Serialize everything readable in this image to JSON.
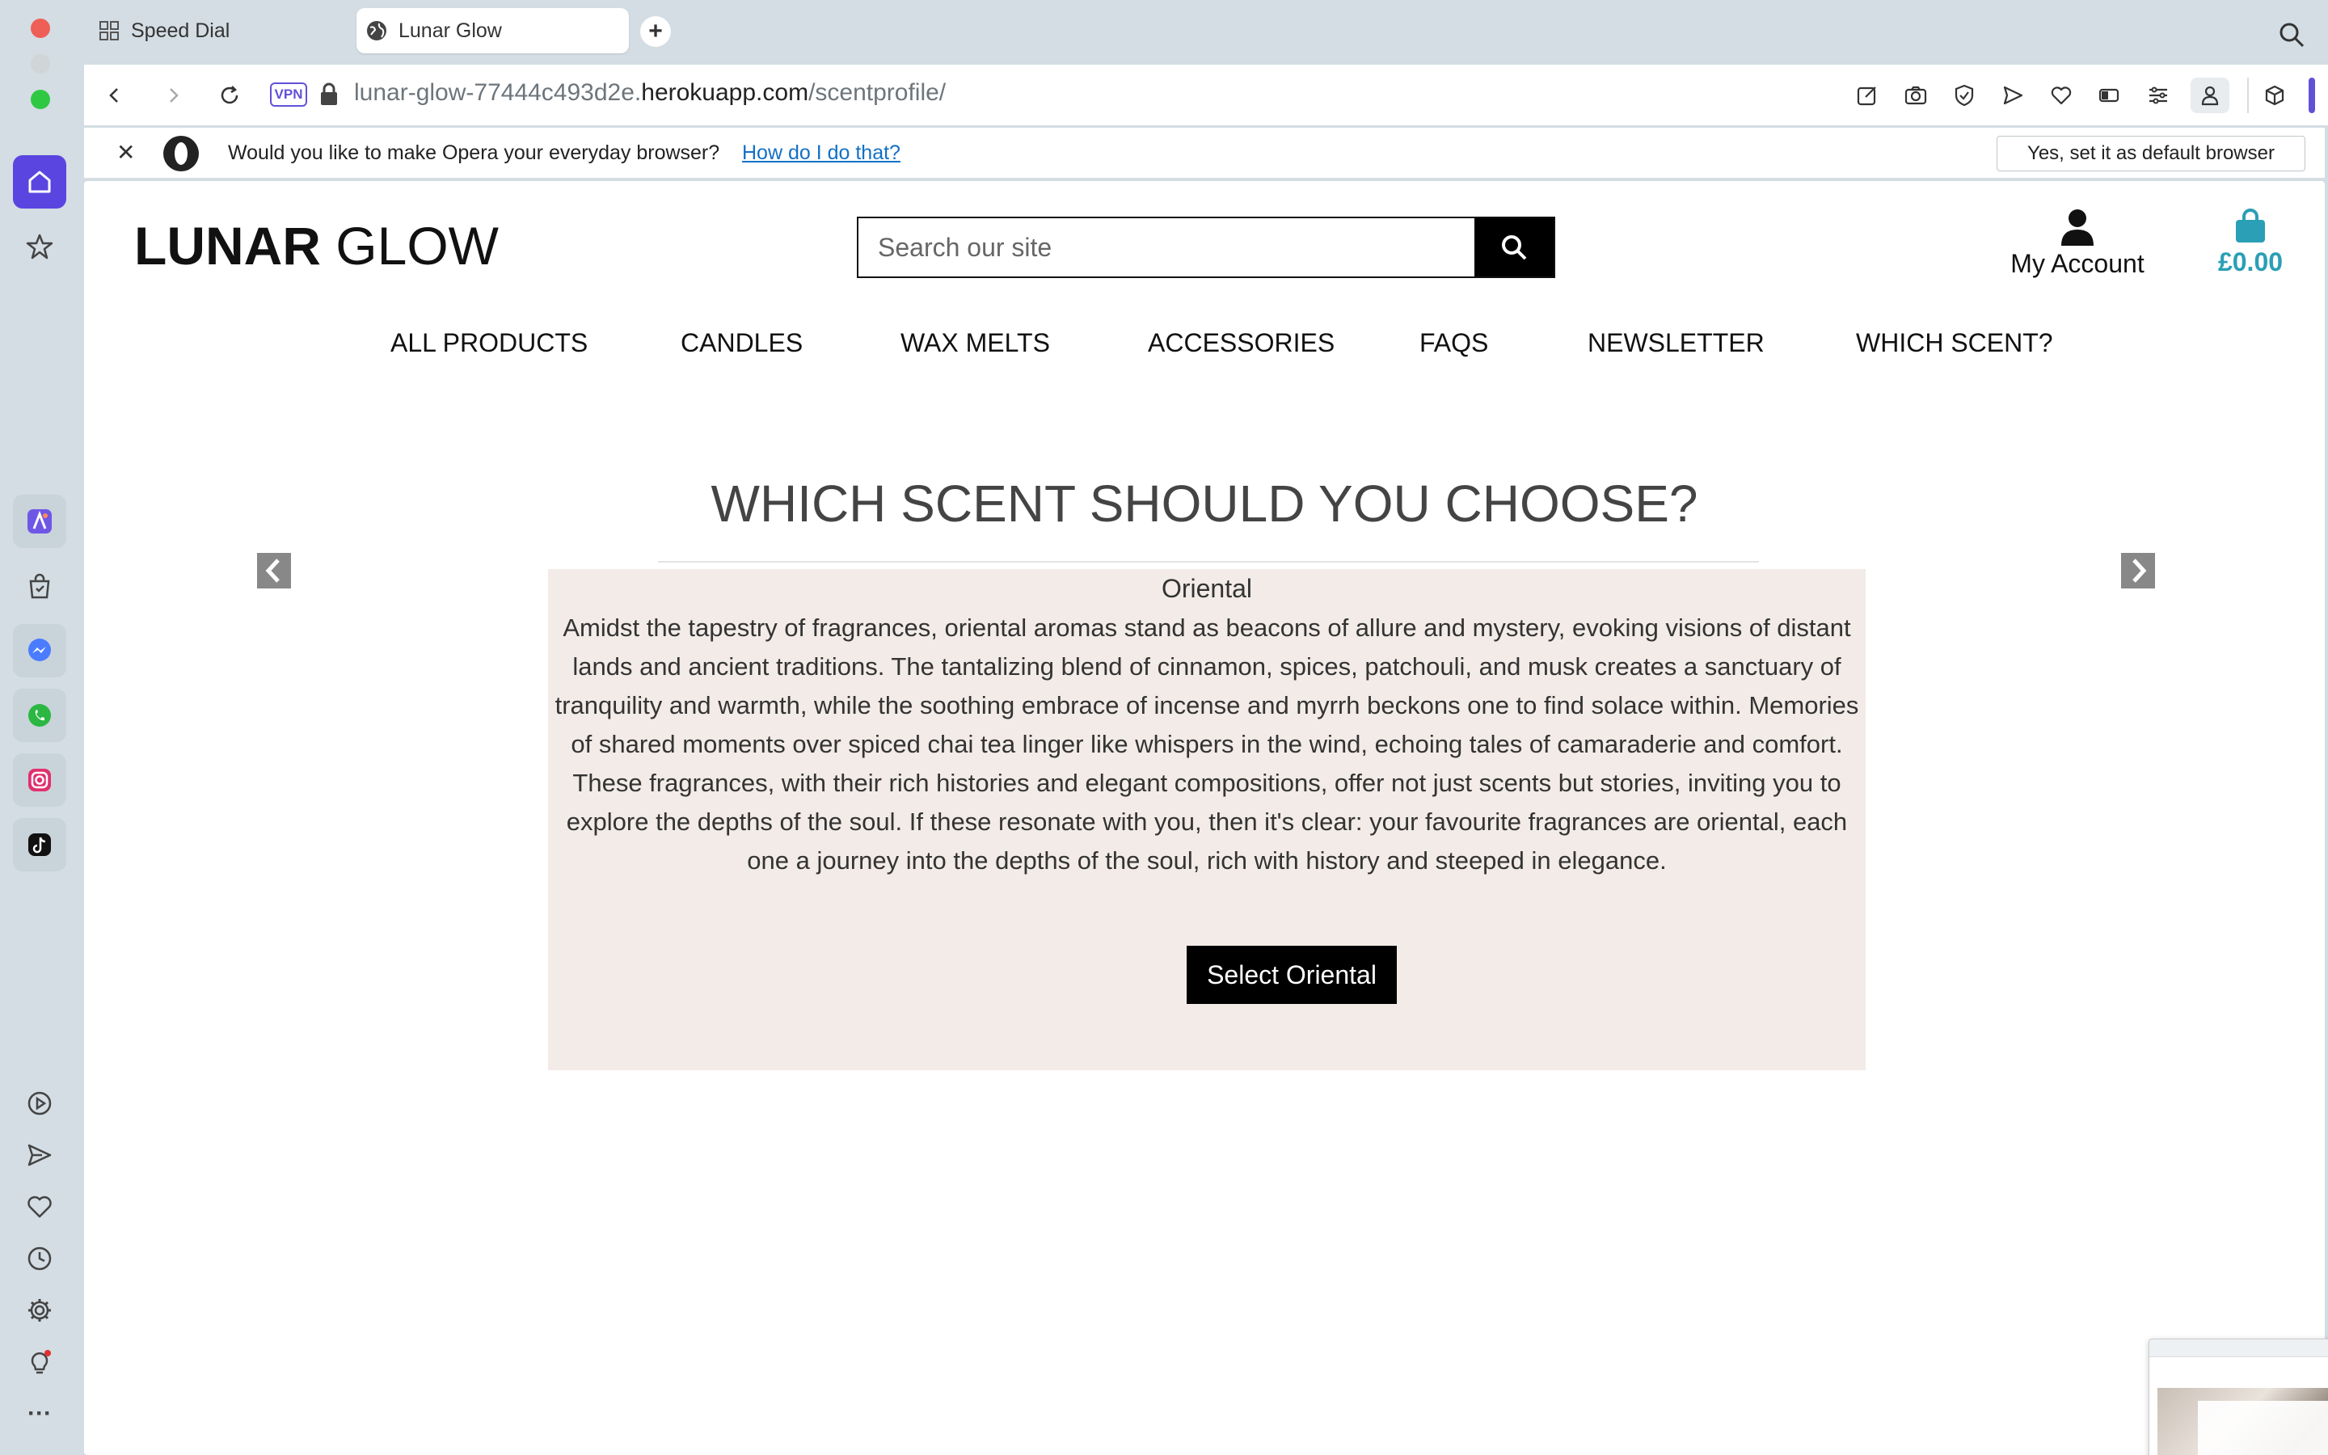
{
  "browser": {
    "tabs": [
      {
        "label": "Speed Dial",
        "icon": "grid-icon",
        "active": false
      },
      {
        "label": "Lunar Glow",
        "icon": "globe-icon",
        "active": true
      }
    ],
    "url": {
      "prefix": "lunar-glow-77444c493d2e.",
      "host": "herokuapp.com",
      "path": "/scentprofile/"
    },
    "vpn_label": "VPN",
    "banner": {
      "text": "Would you like to make Opera your everyday browser?",
      "link": "How do I do that?",
      "button": "Yes, set it as default browser"
    },
    "accent": "#6151d6"
  },
  "site": {
    "logo_bold": "LUNAR",
    "logo_light": " GLOW",
    "search_placeholder": "Search our site",
    "account_label": "My Account",
    "cart_total": "£0.00",
    "nav": [
      "ALL PRODUCTS",
      "CANDLES",
      "WAX MELTS",
      "ACCESSORIES",
      "FAQS",
      "NEWSLETTER",
      "WHICH SCENT?"
    ]
  },
  "main": {
    "heading": "WHICH SCENT SHOULD YOU CHOOSE?",
    "card_title": "Oriental",
    "card_text": "Amidst the tapestry of fragrances, oriental aromas stand as beacons of allure and mystery, evoking visions of distant lands and ancient traditions. The tantalizing blend of cinnamon, spices, patchouli, and musk creates a sanctuary of tranquility and warmth, while the soothing embrace of incense and myrrh beckons one to find solace within. Memories of shared moments over spiced chai tea linger like whispers in the wind, echoing tales of camaraderie and comfort. These fragrances, with their rich histories and elegant compositions, offer not just scents but stories, inviting you to explore the depths of the soul. If these resonate with you, then it's clear: your favourite fragrances are oriental, each one a journey into the depths of the soul, rich with history and steeped in elegance.",
    "select_button": "Select Oriental",
    "card_bg": "#f2ebe7",
    "cart_color": "#2a9fb5"
  }
}
